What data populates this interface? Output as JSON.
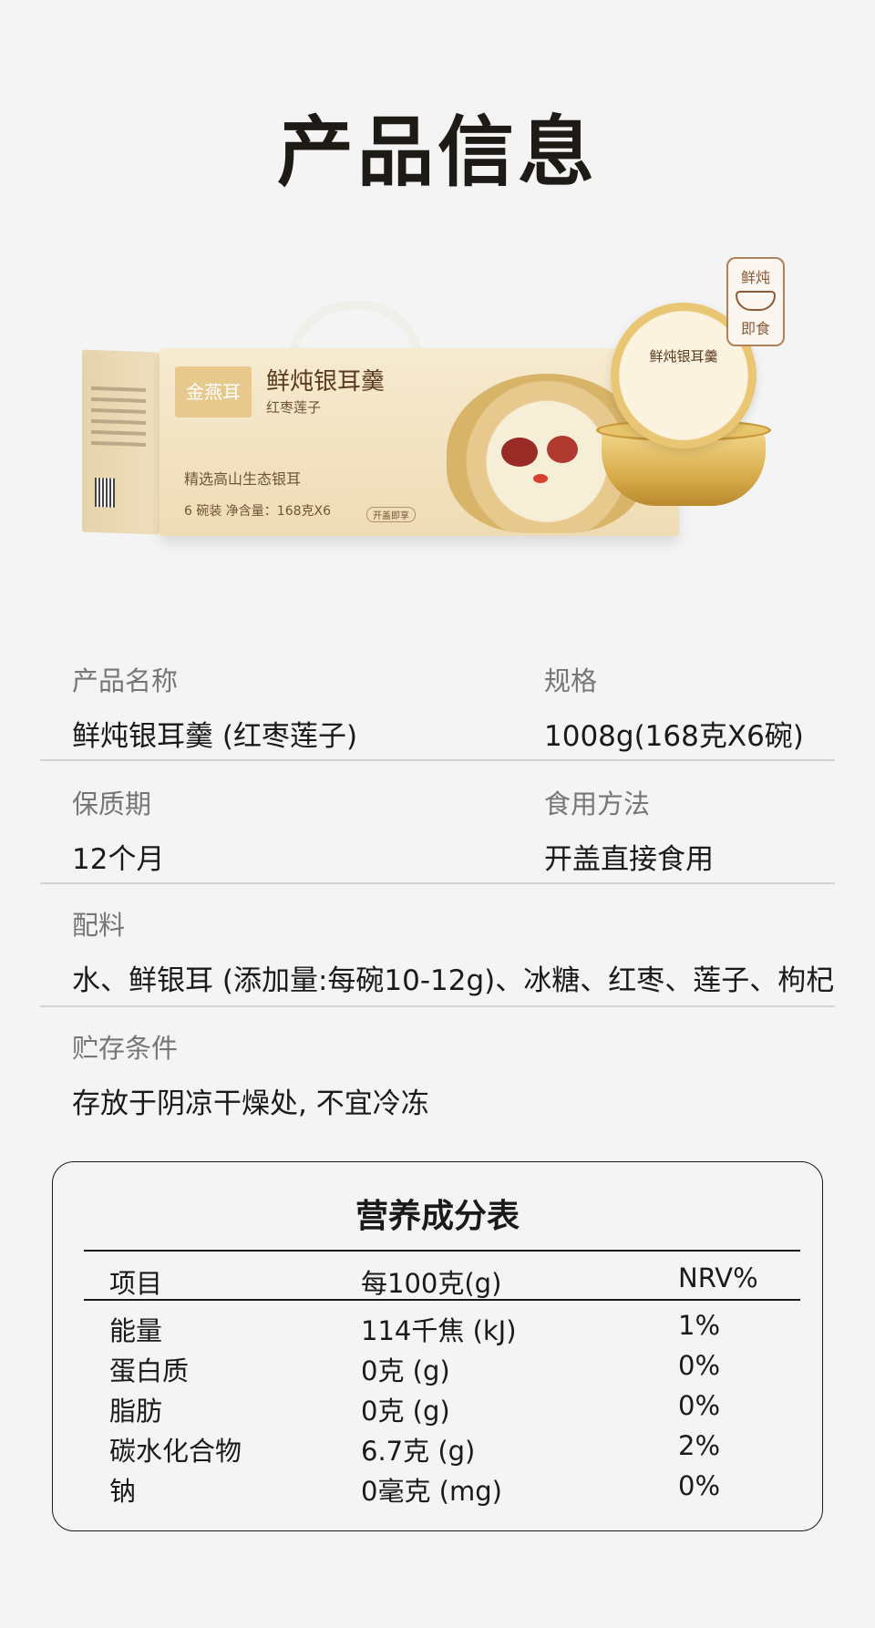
{
  "page_title": "产品信息",
  "product_image": {
    "box_brand": "金燕耳",
    "box_name": "鲜炖银耳羹",
    "box_flavor": "红枣莲子",
    "box_slogan": "精选高山生态银耳",
    "box_net": "6 碗装  净含量：168克X6",
    "box_tag": "开盖即享",
    "lid_name": "鲜炖银耳羹",
    "badge_top": "鲜炖",
    "badge_bottom": "即食"
  },
  "info": {
    "name_label": "产品名称",
    "name_value": "鲜炖银耳羹 (红枣莲子)",
    "spec_label": "规格",
    "spec_value": "1008g(168克X6碗)",
    "shelf_label": "保质期",
    "shelf_value": "12个月",
    "usage_label": "食用方法",
    "usage_value": "开盖直接食用",
    "ingredients_label": "配料",
    "ingredients_value": "水、鲜银耳 (添加量:每碗10-12g)、冰糖、红枣、莲子、枸杞",
    "storage_label": "贮存条件",
    "storage_value": "存放于阴凉干燥处, 不宜冷冻"
  },
  "nutrition": {
    "title": "营养成分表",
    "headers": [
      "项目",
      "每100克(g)",
      "NRV%"
    ],
    "rows": [
      [
        "能量",
        "114千焦 (kJ)",
        "1%"
      ],
      [
        "蛋白质",
        "0克 (g)",
        "0%"
      ],
      [
        "脂肪",
        "0克 (g)",
        "0%"
      ],
      [
        "碳水化合物",
        "6.7克 (g)",
        "2%"
      ],
      [
        "钠",
        "0毫克 (mg)",
        "0%"
      ]
    ]
  }
}
